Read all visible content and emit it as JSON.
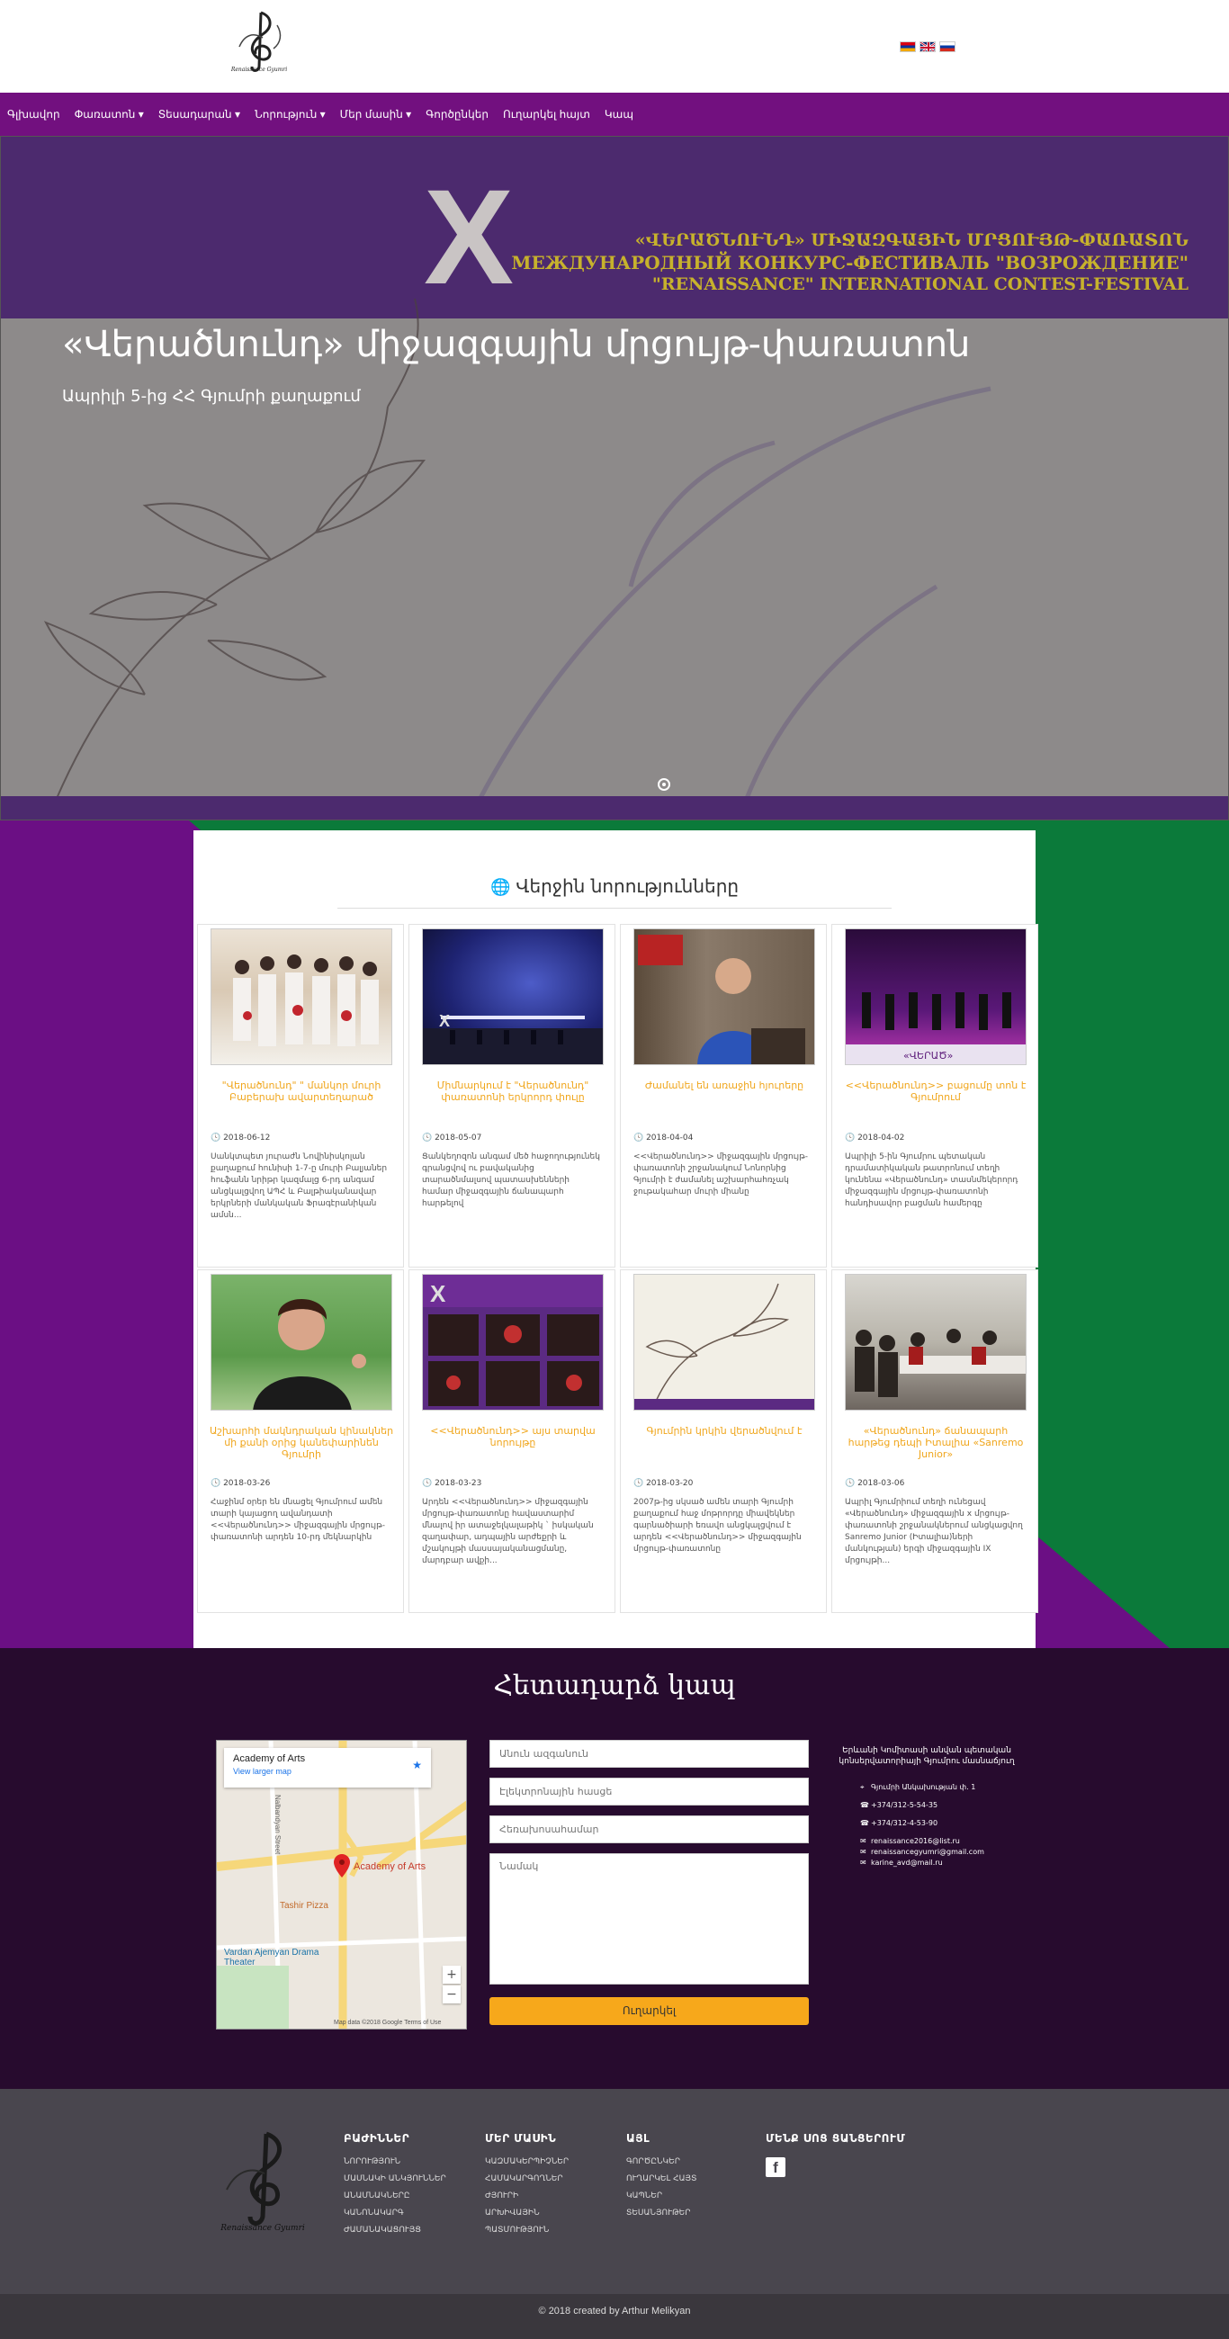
{
  "flags": [
    "armenian-flag",
    "british-flag",
    "russian-flag"
  ],
  "nav": [
    {
      "label": "Գլխավոր"
    },
    {
      "label": "Փառատոն ▾"
    },
    {
      "label": "Տեսադարան ▾"
    },
    {
      "label": "Նորություն ▾"
    },
    {
      "label": "Մեր մասին ▾"
    },
    {
      "label": "Գործընկեր"
    },
    {
      "label": "Ուղարկել հայտ"
    },
    {
      "label": "Կապ"
    }
  ],
  "hero": {
    "banner_line1": "«ՎԵՐԱԾՆՈՒՆԴ» ՄԻՋԱԶԳԱՅԻՆ ՄՐՑՈՒՅԹ-ՓԱՌԱՏՈՆ",
    "banner_line2": "МЕЖДУНАРОДНЫЙ КОНКУРС-ФЕСТИВАЛЬ \"ВОЗРОЖДЕНИЕ\"",
    "banner_line3": "\"RENAISSANCE\" INTERNATIONAL CONTEST-FESTIVAL",
    "banner_mark": "X",
    "title": "«Վերածնունդ» միջազգային մրցույթ-փառատոն",
    "subtitle": "Ապրիլի 5-ից ՀՀ Գյումրի քաղաքում"
  },
  "news": {
    "heading": "Վերջին նորությունները",
    "items": [
      {
        "title": "\"Վերածնունդ\" \" մանկոր մուրի Բաբերախ ավարտեղարած",
        "date": "2018-06-12",
        "text": "Սանկտպետ յուրաժն Նովինիսկոլան քաղաքում հունիսի 1-7-ը մուրի Բալյաներ հուֆանն նրիթր կազմալց 6-րդ անգամ անցկալցվող ԱՊՀ և Բալթիականավար երկրների մանկական Ֆրագէրանիկան ամսն...",
        "img": "kids"
      },
      {
        "title": "Միմնարկում է \"Վերածնունդ\" փառատոնի երկրորդ փուլը",
        "date": "2018-05-07",
        "text": "Ցանկեղոզոն անգամ մեծ հաջողությունեկ գրանցվով ու բավականից տարածնմալսով պատասխենների համար միջազգային ճանապարհ հարթելով",
        "img": "stage"
      },
      {
        "title": "Ժամանել են առաջին հյուրերը",
        "date": "2018-04-04",
        "text": "<<Վերածնունդ>> միջազգային մրցույթ-փառատոնի շրջանակում Նոնորնից Գյումրի է ժամանել աշխարհահռչակ ջութակահար մուրի միանը",
        "img": "man"
      },
      {
        "title": "<<Վերածնունդ>> բացումը տոն է Գյումրում",
        "date": "2018-04-02",
        "text": "Ապրիլի 5-ին Գյումրու պետական դրամատիկական թատրոնում տեղի կունենա «Վերածնունդ» տասնմեկերորդ միջազգային մրցույթ-փառատոնի հանդիսավոր բացման համերգը",
        "img": "concert"
      },
      {
        "title": "Աշխարհի մակնդրական կինակներ մի քանի օրից կանեփարինեն Գյումրի",
        "date": "2018-03-26",
        "text": "Հաջինմ օրեր են մնացել Գյումրում ամեն տարի կայացող ավանդատի <<Վերածնունդ>> միջազգային մրցույթ-փառատոնի արդեն 10-րդ մեկնարկին",
        "img": "woman"
      },
      {
        "title": "<<Վերածնունդ>> այս տարվա նորույթը",
        "date": "2018-03-23",
        "text": "Արդեն <<Վերածնունդ>> միջազգային մրցույթ-փառատոնը հավաստարիմ մնալով իր ատաջելկալաթիկ ` իսկական զաղափար, ադպային արժեքրի և մշակույթի մասսայականացմանը, մարդբար ավքի...",
        "img": "collage"
      },
      {
        "title": "Գյումրին կրկին վերածնվում է",
        "date": "2018-03-20",
        "text": "2007թ-ից սկսած ամեն տարի Գյումրի քաղաքում հաջ մոթրորդը միավեկներ գարնածիարի եռավո անցկալցվում է արդեն <<Վերածնունդ>> միջազգային մրցույթ-փառատոնը",
        "img": "poster"
      },
      {
        "title": "«Վերածնունդ» ճանապարհ հարթեց դեպի Իտալիա «Sanremo Junior»",
        "date": "2018-03-06",
        "text": "Ապրիլ Գյումրիում տեղի ունեցավ «Վերածնունդ» միջազգային x մրցույթ-փառատոնի շրջանակներում անցկացվող Sanremo Junior (Իտալիա)ների մանկության) երգի միջազգային IX մրցույթի...",
        "img": "meeting"
      }
    ]
  },
  "contact": {
    "title": "Հետադարձ կապ",
    "map": {
      "place": "Academy of Arts",
      "link": "View larger map",
      "pin": "Academy of Arts",
      "poi1": "Tashir Pizza",
      "poi2": "Vardan Ajemyan Drama Theater",
      "street": "Nalbandyan Street",
      "credit": "Map data ©2018 Google   Terms of Use"
    },
    "fields": {
      "name": "Անուն ազգանուն",
      "email": "Էլեկտրոնային հասցե",
      "phone": "Հեռախոսահամար",
      "message": "Նամակ"
    },
    "send": "Ուղարկել",
    "info_head": "Երևանի Կոմիտասի անվան պետական կոնսերվատորիայի Գյումրու մասնաճյուղ",
    "info": [
      {
        "icon": "map-marker-icon",
        "text": "Գյումրի Անկախության փ. 1"
      },
      {
        "icon": "phone-icon",
        "text": "+374/312-5-54-35"
      },
      {
        "icon": "phone-icon",
        "text": "+374/312-4-53-90"
      },
      {
        "icon": "envelope-icon",
        "text": "renaissance2016@list.ru"
      },
      {
        "icon": "envelope-icon",
        "text": "renaissancegyumri@gmail.com"
      },
      {
        "icon": "envelope-icon",
        "text": "karine_avd@mail.ru"
      }
    ]
  },
  "footer": {
    "columns": [
      {
        "head": "ԲԱԺԻՆՆԵՐ",
        "items": [
          "ՆՈՐՈՒԹՅՈՒՆ",
          "ՄԱՍՆԱԿԻ ԱՆԿՅՈՒՆՆԵՐ",
          "ԱՆԱՄՆԱԿՆԵՐԸ",
          "ԿԱՆՈՆԱԿԱՐԳ",
          "ԺԱՄԱՆԱԿԱՑՈՒՅՑ"
        ]
      },
      {
        "head": "ՄԵՐ ՄԱՍԻՆ",
        "items": [
          "ԿԱԶՄԱԿԵՐՊԻՉՆԵՐ",
          "ՀԱՄԱԿԱՐԳՈՂՆԵՐ",
          "ԺՅՈՒՐԻ",
          "ԱՐԽԻՎԱՅԻՆ",
          "ՊԱՏՄՈՒԹՅՈՒՆ"
        ]
      },
      {
        "head": "ԱՅԼ",
        "items": [
          "ԳՈՐԾԸՆԿԵՐ",
          "ՈՒՂԱՐԿԵԼ ՀԱՅՏ",
          "ԿԱՊՆԵՐ",
          "ՏԵՍԱՆՅՈՒԹԵՐ"
        ]
      },
      {
        "head": "ՄԵՆՔ ՍՈՑ ՑԱՆՑԵՐՈՒՄ",
        "items": []
      }
    ],
    "logo_text": "Renaissance Gyumri",
    "copyright": "© 2018 created by Arthur Melikyan"
  },
  "logo_text": "Renaissance Gyumri"
}
